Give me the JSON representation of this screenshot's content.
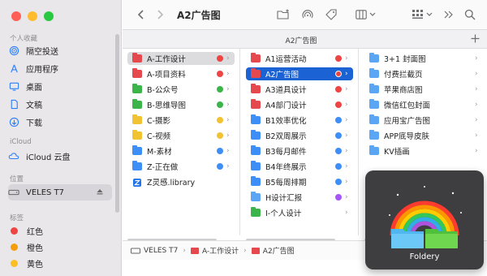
{
  "window": {
    "title": "A2广告图",
    "tab_label": "A2广告图"
  },
  "sidebar": {
    "favorites_header": "个人收藏",
    "favorites": [
      {
        "label": "隔空投送",
        "icon": "airdrop-icon"
      },
      {
        "label": "应用程序",
        "icon": "applications-icon"
      },
      {
        "label": "桌面",
        "icon": "desktop-icon"
      },
      {
        "label": "文稿",
        "icon": "document-icon"
      },
      {
        "label": "下载",
        "icon": "download-icon"
      }
    ],
    "icloud_header": "iCloud",
    "icloud": [
      {
        "label": "iCloud 云盘",
        "icon": "cloud-icon"
      }
    ],
    "locations_header": "位置",
    "locations": [
      {
        "label": "VELES T7",
        "icon": "drive-icon"
      }
    ],
    "tags_header": "标签",
    "tags": [
      {
        "label": "红色",
        "color": "#ef4444"
      },
      {
        "label": "橙色",
        "color": "#f59e0b"
      },
      {
        "label": "黄色",
        "color": "#fbbf24"
      }
    ]
  },
  "columns": {
    "col1": [
      {
        "label": "A-工作设计",
        "folder": "red",
        "tag": "#ef4444",
        "chevron": true,
        "selected": "grey"
      },
      {
        "label": "A-项目资料",
        "folder": "red",
        "tag": "#ef4444",
        "chevron": true
      },
      {
        "label": "B-公众号",
        "folder": "green",
        "tag": "#3bb54a",
        "chevron": true
      },
      {
        "label": "B-思维导图",
        "folder": "green",
        "tag": "#3bb54a",
        "chevron": true
      },
      {
        "label": "C-摄影",
        "folder": "yellow",
        "tag": "#f1c232",
        "chevron": true
      },
      {
        "label": "C-视频",
        "folder": "yellow",
        "tag": "#f1c232",
        "chevron": true
      },
      {
        "label": "M-素材",
        "folder": "blue",
        "tag": "#3e8ef7",
        "chevron": true
      },
      {
        "label": "Z-正在做",
        "folder": "blue",
        "tag": "#3e8ef7",
        "chevron": true
      },
      {
        "label": "Z灵感.library",
        "folder": "lib",
        "tag": null,
        "chevron": false
      }
    ],
    "col2": [
      {
        "label": "A1运营活动",
        "folder": "red",
        "tag": "#ef4444",
        "chevron": true
      },
      {
        "label": "A2广告图",
        "folder": "red",
        "tag": "#ef4444",
        "chevron": true,
        "selected": "blue"
      },
      {
        "label": "A3道具设计",
        "folder": "red",
        "tag": "#ef4444",
        "chevron": true
      },
      {
        "label": "A4部门设计",
        "folder": "red",
        "tag": "#ef4444",
        "chevron": true
      },
      {
        "label": "B1效率优化",
        "folder": "blue",
        "tag": "#3e8ef7",
        "chevron": true
      },
      {
        "label": "B2双周展示",
        "folder": "blue",
        "tag": "#3e8ef7",
        "chevron": true
      },
      {
        "label": "B3每月邮件",
        "folder": "blue",
        "tag": "#3e8ef7",
        "chevron": true
      },
      {
        "label": "B4年终展示",
        "folder": "blue",
        "tag": "#3e8ef7",
        "chevron": true
      },
      {
        "label": "B5每周排期",
        "folder": "blue",
        "tag": "#3e8ef7",
        "chevron": true
      },
      {
        "label": "H设计汇报",
        "folder": "lightblue",
        "tag": "#a855f7",
        "chevron": true
      },
      {
        "label": "I-个人设计",
        "folder": "green",
        "tag": null,
        "chevron": true
      }
    ],
    "col3": [
      {
        "label": "3+1 封面图",
        "folder": "lightblue",
        "chevron": true
      },
      {
        "label": "付费拦截页",
        "folder": "lightblue",
        "chevron": true
      },
      {
        "label": "苹果商店图",
        "folder": "lightblue",
        "chevron": true
      },
      {
        "label": "微信红包封面",
        "folder": "lightblue",
        "chevron": true
      },
      {
        "label": "应用宝广告图",
        "folder": "lightblue",
        "chevron": true
      },
      {
        "label": "APP底导皮肤",
        "folder": "lightblue",
        "chevron": true
      },
      {
        "label": "KV插画",
        "folder": "lightblue",
        "chevron": true
      }
    ]
  },
  "pathbar": {
    "segments": [
      "VELES T7",
      "A-工作设计",
      "A2广告图"
    ]
  },
  "overlay": {
    "app_name": "Foldery"
  },
  "colors": {
    "selection_blue": "#1b62d4",
    "accent": "#2d7ff9"
  }
}
